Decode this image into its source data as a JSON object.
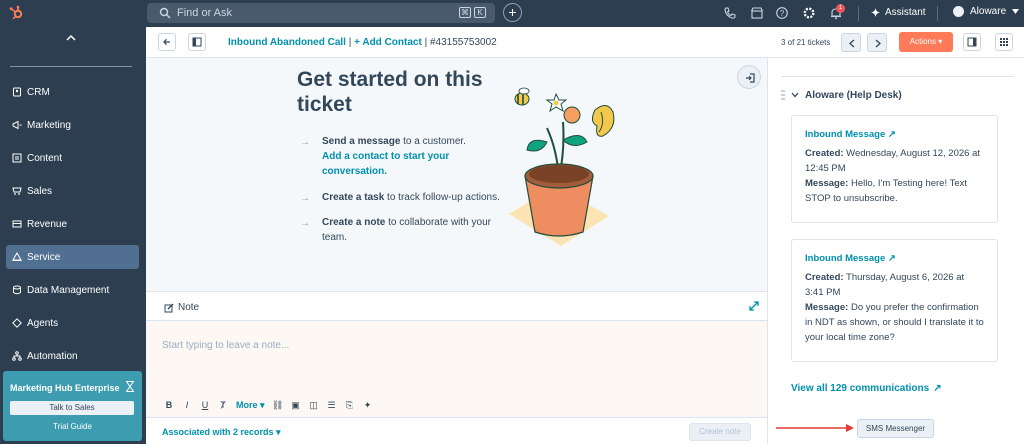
{
  "topbar": {
    "search_placeholder": "Find or Ask",
    "kbd_cmd": "⌘",
    "kbd_k": "K",
    "notification_count": "1",
    "assistant_label": "Assistant",
    "account_name": "Aloware",
    "brand_color": "#ff7a59"
  },
  "sidebar": {
    "items": [
      {
        "label": "CRM",
        "icon": "contact-icon"
      },
      {
        "label": "Marketing",
        "icon": "megaphone-icon"
      },
      {
        "label": "Content",
        "icon": "document-icon"
      },
      {
        "label": "Sales",
        "icon": "sales-icon"
      },
      {
        "label": "Revenue",
        "icon": "revenue-icon"
      },
      {
        "label": "Service",
        "icon": "service-icon"
      },
      {
        "label": "Data Management",
        "icon": "database-icon"
      },
      {
        "label": "Agents",
        "icon": "agents-icon"
      },
      {
        "label": "Automation",
        "icon": "automation-icon"
      }
    ],
    "active": "Service",
    "promo": {
      "title": "Marketing Hub Enterprise",
      "button": "Talk to Sales",
      "link": "Trial Guide"
    }
  },
  "record_header": {
    "crumb_ticket": "Inbound Abandoned Call",
    "crumb_sep": " | ",
    "crumb_add_contact": "+ Add Contact",
    "crumb_id": " | #43155753002",
    "count": "3 of 21 tickets",
    "actions_label": "Actions ▾"
  },
  "getting_started": {
    "title": "Get started on this ticket",
    "steps": [
      {
        "bold": "Send a message",
        "rest": " to a customer.",
        "link": "Add a contact to start your conversation."
      },
      {
        "bold": "Create a task",
        "rest": " to track follow-up actions.",
        "link": ""
      },
      {
        "bold": "Create a note",
        "rest": " to collaborate with your team.",
        "link": ""
      }
    ]
  },
  "note": {
    "tab_label": "Note",
    "placeholder": "Start typing to leave a note...",
    "more_label": "More ▾",
    "associated": "Associated with 2 records ▾",
    "create_label": "Create note"
  },
  "right_panel": {
    "section_title": "Aloware (Help Desk)",
    "cards": [
      {
        "title": "Inbound Message",
        "created_label": "Created:",
        "created_value": " Wednesday, August 12, 2026 at 12:45 PM",
        "message_label": "Message:",
        "message_value": " Hello, I'm Testing here! Text STOP to unsubscribe."
      },
      {
        "title": "Inbound Message",
        "created_label": "Created:",
        "created_value": " Thursday, August 6, 2026 at 3:41 PM",
        "message_label": "Message:",
        "message_value": " Do you prefer the confirmation in NDT as shown, or should I translate it to your local time zone?"
      }
    ],
    "view_all": "View all 129 communications",
    "sms_button": "SMS Messenger"
  }
}
